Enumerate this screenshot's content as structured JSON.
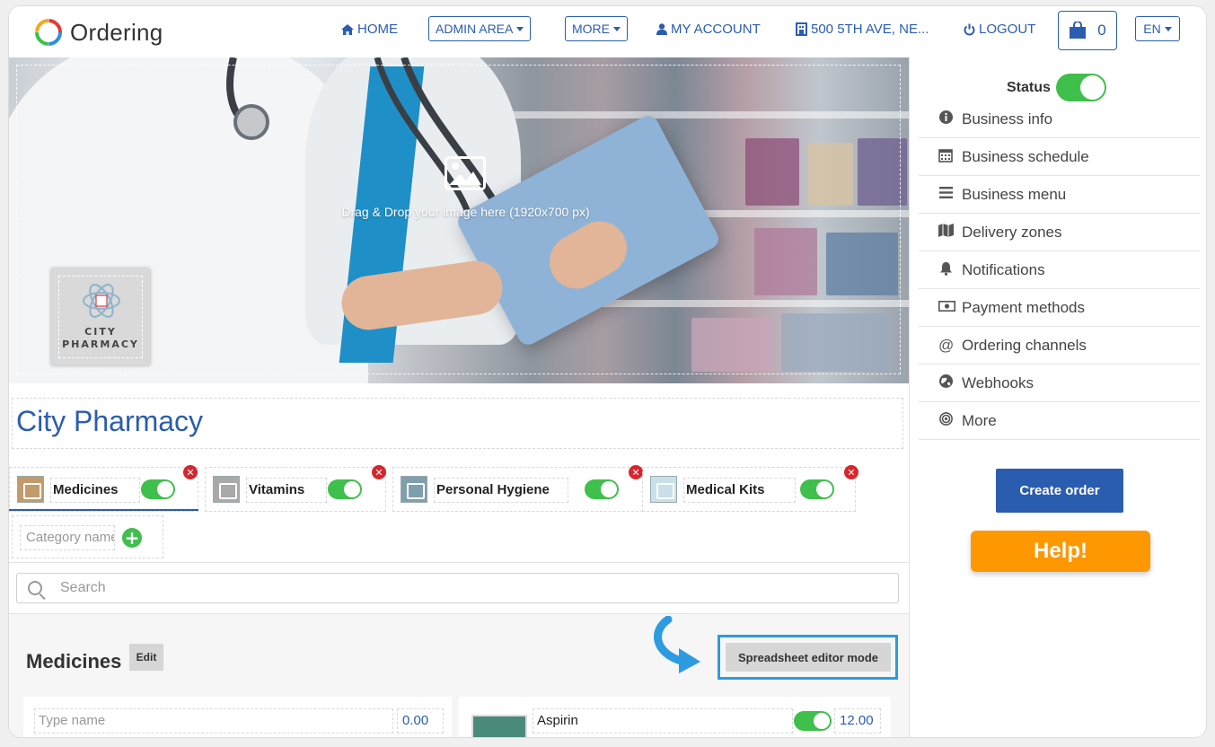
{
  "nav": {
    "brand": "Ordering",
    "home": "HOME",
    "admin_area": "ADMIN AREA",
    "more": "MORE",
    "my_account": "MY ACCOUNT",
    "address": "500 5TH AVE, NE...",
    "logout": "LOGOUT",
    "cart_count": "0",
    "language": "EN"
  },
  "hero": {
    "drop_text": "Drag & Drop your image here (1920x700 px)",
    "logo_line1": "CITY",
    "logo_line2": "PHARMACY"
  },
  "business": {
    "name": "City Pharmacy"
  },
  "categories": [
    {
      "name": "Medicines",
      "enabled": true,
      "active": true
    },
    {
      "name": "Vitamins",
      "enabled": true,
      "active": false
    },
    {
      "name": "Personal Hygiene",
      "enabled": true,
      "active": false
    },
    {
      "name": "Medical Kits",
      "enabled": true,
      "active": false
    }
  ],
  "new_category": {
    "placeholder": "Category name"
  },
  "search": {
    "placeholder": "Search"
  },
  "section": {
    "title": "Medicines",
    "edit_label": "Edit",
    "spreadsheet_label": "Spreadsheet editor mode"
  },
  "products": {
    "new_name_placeholder": "Type name",
    "new_price": "0.00",
    "item_name": "Aspirin",
    "item_price": "12.00",
    "item_enabled": true
  },
  "sidebar": {
    "status_label": "Status",
    "status_on": true,
    "items": [
      {
        "label": "Business info",
        "icon": "info-icon"
      },
      {
        "label": "Business schedule",
        "icon": "calendar-icon"
      },
      {
        "label": "Business menu",
        "icon": "list-icon"
      },
      {
        "label": "Delivery zones",
        "icon": "map-icon"
      },
      {
        "label": "Notifications",
        "icon": "bell-icon"
      },
      {
        "label": "Payment methods",
        "icon": "money-icon"
      },
      {
        "label": "Ordering channels",
        "icon": "at-icon"
      },
      {
        "label": "Webhooks",
        "icon": "globe-icon"
      },
      {
        "label": "More",
        "icon": "target-icon"
      }
    ],
    "create_order": "Create order",
    "help": "Help!"
  },
  "colors": {
    "primary": "#2a5db0",
    "toggle_on": "#3fbf4b",
    "help": "#ff9700",
    "delete": "#d6262e",
    "highlight": "#2d9be0"
  }
}
